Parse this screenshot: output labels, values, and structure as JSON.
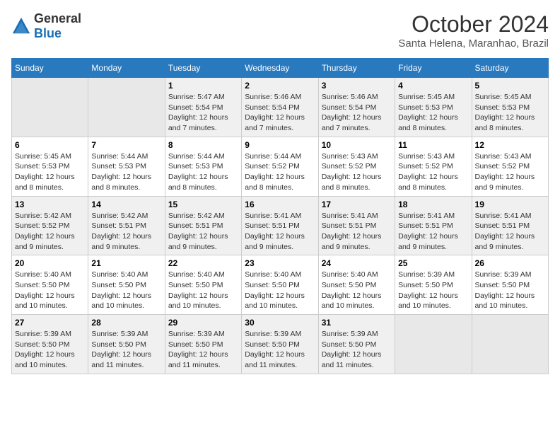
{
  "logo": {
    "general": "General",
    "blue": "Blue"
  },
  "title": "October 2024",
  "subtitle": "Santa Helena, Maranhao, Brazil",
  "days_of_week": [
    "Sunday",
    "Monday",
    "Tuesday",
    "Wednesday",
    "Thursday",
    "Friday",
    "Saturday"
  ],
  "weeks": [
    [
      {
        "day": "",
        "info": ""
      },
      {
        "day": "",
        "info": ""
      },
      {
        "day": "1",
        "info": "Sunrise: 5:47 AM\nSunset: 5:54 PM\nDaylight: 12 hours\nand 7 minutes."
      },
      {
        "day": "2",
        "info": "Sunrise: 5:46 AM\nSunset: 5:54 PM\nDaylight: 12 hours\nand 7 minutes."
      },
      {
        "day": "3",
        "info": "Sunrise: 5:46 AM\nSunset: 5:54 PM\nDaylight: 12 hours\nand 7 minutes."
      },
      {
        "day": "4",
        "info": "Sunrise: 5:45 AM\nSunset: 5:53 PM\nDaylight: 12 hours\nand 8 minutes."
      },
      {
        "day": "5",
        "info": "Sunrise: 5:45 AM\nSunset: 5:53 PM\nDaylight: 12 hours\nand 8 minutes."
      }
    ],
    [
      {
        "day": "6",
        "info": "Sunrise: 5:45 AM\nSunset: 5:53 PM\nDaylight: 12 hours\nand 8 minutes."
      },
      {
        "day": "7",
        "info": "Sunrise: 5:44 AM\nSunset: 5:53 PM\nDaylight: 12 hours\nand 8 minutes."
      },
      {
        "day": "8",
        "info": "Sunrise: 5:44 AM\nSunset: 5:53 PM\nDaylight: 12 hours\nand 8 minutes."
      },
      {
        "day": "9",
        "info": "Sunrise: 5:44 AM\nSunset: 5:52 PM\nDaylight: 12 hours\nand 8 minutes."
      },
      {
        "day": "10",
        "info": "Sunrise: 5:43 AM\nSunset: 5:52 PM\nDaylight: 12 hours\nand 8 minutes."
      },
      {
        "day": "11",
        "info": "Sunrise: 5:43 AM\nSunset: 5:52 PM\nDaylight: 12 hours\nand 8 minutes."
      },
      {
        "day": "12",
        "info": "Sunrise: 5:43 AM\nSunset: 5:52 PM\nDaylight: 12 hours\nand 9 minutes."
      }
    ],
    [
      {
        "day": "13",
        "info": "Sunrise: 5:42 AM\nSunset: 5:52 PM\nDaylight: 12 hours\nand 9 minutes."
      },
      {
        "day": "14",
        "info": "Sunrise: 5:42 AM\nSunset: 5:51 PM\nDaylight: 12 hours\nand 9 minutes."
      },
      {
        "day": "15",
        "info": "Sunrise: 5:42 AM\nSunset: 5:51 PM\nDaylight: 12 hours\nand 9 minutes."
      },
      {
        "day": "16",
        "info": "Sunrise: 5:41 AM\nSunset: 5:51 PM\nDaylight: 12 hours\nand 9 minutes."
      },
      {
        "day": "17",
        "info": "Sunrise: 5:41 AM\nSunset: 5:51 PM\nDaylight: 12 hours\nand 9 minutes."
      },
      {
        "day": "18",
        "info": "Sunrise: 5:41 AM\nSunset: 5:51 PM\nDaylight: 12 hours\nand 9 minutes."
      },
      {
        "day": "19",
        "info": "Sunrise: 5:41 AM\nSunset: 5:51 PM\nDaylight: 12 hours\nand 9 minutes."
      }
    ],
    [
      {
        "day": "20",
        "info": "Sunrise: 5:40 AM\nSunset: 5:50 PM\nDaylight: 12 hours\nand 10 minutes."
      },
      {
        "day": "21",
        "info": "Sunrise: 5:40 AM\nSunset: 5:50 PM\nDaylight: 12 hours\nand 10 minutes."
      },
      {
        "day": "22",
        "info": "Sunrise: 5:40 AM\nSunset: 5:50 PM\nDaylight: 12 hours\nand 10 minutes."
      },
      {
        "day": "23",
        "info": "Sunrise: 5:40 AM\nSunset: 5:50 PM\nDaylight: 12 hours\nand 10 minutes."
      },
      {
        "day": "24",
        "info": "Sunrise: 5:40 AM\nSunset: 5:50 PM\nDaylight: 12 hours\nand 10 minutes."
      },
      {
        "day": "25",
        "info": "Sunrise: 5:39 AM\nSunset: 5:50 PM\nDaylight: 12 hours\nand 10 minutes."
      },
      {
        "day": "26",
        "info": "Sunrise: 5:39 AM\nSunset: 5:50 PM\nDaylight: 12 hours\nand 10 minutes."
      }
    ],
    [
      {
        "day": "27",
        "info": "Sunrise: 5:39 AM\nSunset: 5:50 PM\nDaylight: 12 hours\nand 10 minutes."
      },
      {
        "day": "28",
        "info": "Sunrise: 5:39 AM\nSunset: 5:50 PM\nDaylight: 12 hours\nand 11 minutes."
      },
      {
        "day": "29",
        "info": "Sunrise: 5:39 AM\nSunset: 5:50 PM\nDaylight: 12 hours\nand 11 minutes."
      },
      {
        "day": "30",
        "info": "Sunrise: 5:39 AM\nSunset: 5:50 PM\nDaylight: 12 hours\nand 11 minutes."
      },
      {
        "day": "31",
        "info": "Sunrise: 5:39 AM\nSunset: 5:50 PM\nDaylight: 12 hours\nand 11 minutes."
      },
      {
        "day": "",
        "info": ""
      },
      {
        "day": "",
        "info": ""
      }
    ]
  ]
}
